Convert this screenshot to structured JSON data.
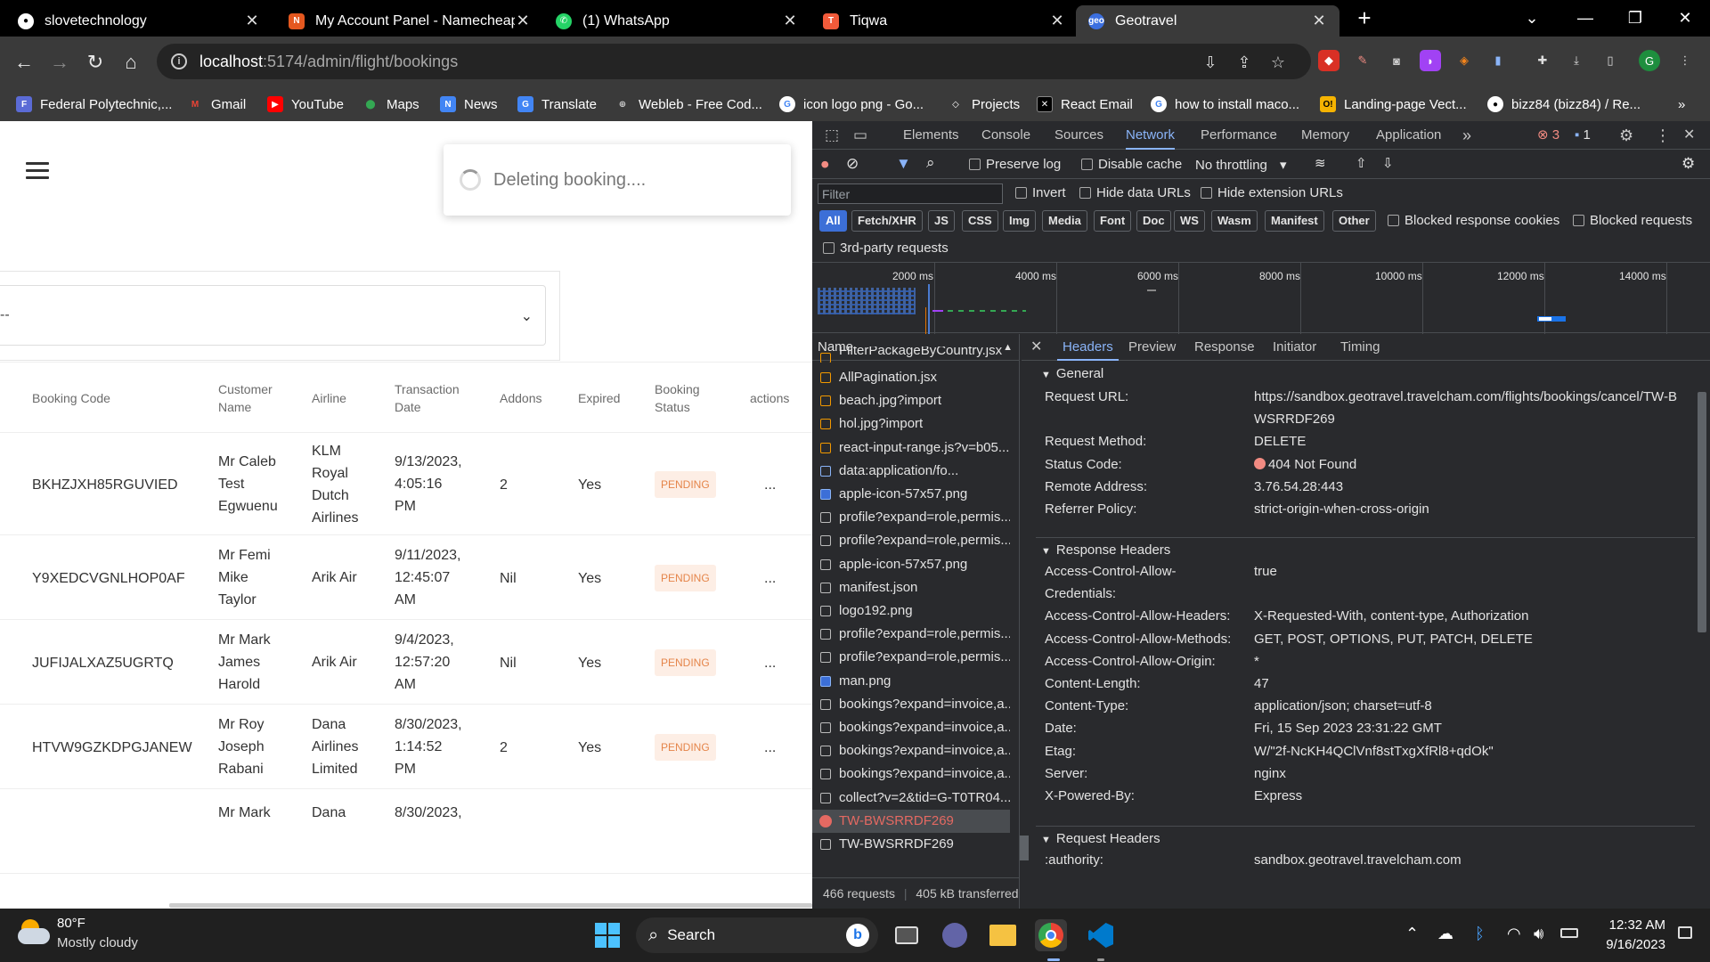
{
  "tabs": [
    {
      "title": "slovetechnology",
      "icon": "github-icon"
    },
    {
      "title": "My Account Panel - Namecheap",
      "icon": "namecheap-icon"
    },
    {
      "title": "(1) WhatsApp",
      "icon": "whatsapp-icon"
    },
    {
      "title": "Tiqwa",
      "icon": "tiqwa-icon"
    },
    {
      "title": "Geotravel",
      "icon": "geotravel-icon"
    }
  ],
  "omnibox": {
    "host": "localhost",
    "path": ":5174/admin/flight/bookings"
  },
  "bookmarks": [
    "Federal Polytechnic,...",
    "Gmail",
    "YouTube",
    "Maps",
    "News",
    "Translate",
    "Webleb - Free Cod...",
    "icon logo png - Go...",
    "Projects",
    "React Email",
    "how to install maco...",
    "Landing-page Vect...",
    "bizz84 (bizz84) / Re..."
  ],
  "page": {
    "toast": "Deleting booking....",
    "select_value": "--",
    "headers": [
      "Booking Code",
      "Customer Name",
      "Airline",
      "Transaction Date",
      "Addons",
      "Expired",
      "Booking Status",
      "actions"
    ],
    "rows": [
      {
        "code": "BKHZJXH85RGUVIED",
        "customer": [
          "Mr Caleb",
          "Test",
          "Egwuenu"
        ],
        "airline": [
          "KLM",
          "Royal",
          "Dutch",
          "Airlines"
        ],
        "date": [
          "9/13/2023,",
          "4:05:16",
          "PM"
        ],
        "addons": "2",
        "expired": "Yes",
        "status": "PENDING",
        "actions": "..."
      },
      {
        "code": "Y9XEDCVGNLHOP0AF",
        "customer": [
          "Mr Femi",
          "Mike",
          "Taylor"
        ],
        "airline": [
          "Arik Air"
        ],
        "date": [
          "9/11/2023,",
          "12:45:07",
          "AM"
        ],
        "addons": "Nil",
        "expired": "Yes",
        "status": "PENDING",
        "actions": "..."
      },
      {
        "code": "JUFIJALXAZ5UGRTQ",
        "customer": [
          "Mr Mark",
          "James",
          "Harold"
        ],
        "airline": [
          "Arik Air"
        ],
        "date": [
          "9/4/2023,",
          "12:57:20",
          "AM"
        ],
        "addons": "Nil",
        "expired": "Yes",
        "status": "PENDING",
        "actions": "..."
      },
      {
        "code": "HTVW9GZKDPGJANEW",
        "customer": [
          "Mr Roy",
          "Joseph",
          "Rabani"
        ],
        "airline": [
          "Dana",
          "Airlines",
          "Limited"
        ],
        "date": [
          "8/30/2023,",
          "1:14:52",
          "PM"
        ],
        "addons": "2",
        "expired": "Yes",
        "status": "PENDING",
        "actions": "..."
      },
      {
        "code": "",
        "customer": [
          "Mr Mark"
        ],
        "airline": [
          "Dana"
        ],
        "date": [
          "8/30/2023,"
        ],
        "addons": "",
        "expired": "",
        "status": "",
        "actions": ""
      }
    ]
  },
  "devtools": {
    "tabs": [
      "Elements",
      "Console",
      "Sources",
      "Network",
      "Performance",
      "Memory",
      "Application"
    ],
    "errors": "3",
    "messages": "1",
    "toolbar": {
      "preserve": "Preserve log",
      "disable_cache": "Disable cache",
      "throttle": "No throttling"
    },
    "filter_placeholder": "Filter",
    "filter_opts": [
      "Invert",
      "Hide data URLs",
      "Hide extension URLs"
    ],
    "types": [
      "All",
      "Fetch/XHR",
      "JS",
      "CSS",
      "Img",
      "Media",
      "Font",
      "Doc",
      "WS",
      "Wasm",
      "Manifest",
      "Other"
    ],
    "blocked": [
      "Blocked response cookies",
      "Blocked requests"
    ],
    "third_party": "3rd-party requests",
    "ticks": [
      "2000 ms",
      "4000 ms",
      "6000 ms",
      "8000 ms",
      "10000 ms",
      "12000 ms",
      "14000 ms"
    ],
    "name_header": "Name",
    "requests": [
      {
        "name": "FilterPackageByCountry.jsx",
        "type": "js"
      },
      {
        "name": "AllPagination.jsx",
        "type": "js"
      },
      {
        "name": "beach.jpg?import",
        "type": "js"
      },
      {
        "name": "hol.jpg?import",
        "type": "js"
      },
      {
        "name": "react-input-range.js?v=b05...",
        "type": "js"
      },
      {
        "name": "data:application/fo...",
        "type": "font"
      },
      {
        "name": "apple-icon-57x57.png",
        "type": "img"
      },
      {
        "name": "profile?expand=role,permis...",
        "type": "doc"
      },
      {
        "name": "profile?expand=role,permis...",
        "type": "doc"
      },
      {
        "name": "apple-icon-57x57.png",
        "type": "doc"
      },
      {
        "name": "manifest.json",
        "type": "doc"
      },
      {
        "name": "logo192.png",
        "type": "doc"
      },
      {
        "name": "profile?expand=role,permis...",
        "type": "doc"
      },
      {
        "name": "profile?expand=role,permis...",
        "type": "doc"
      },
      {
        "name": "man.png",
        "type": "img"
      },
      {
        "name": "bookings?expand=invoice,a...",
        "type": "doc"
      },
      {
        "name": "bookings?expand=invoice,a...",
        "type": "doc"
      },
      {
        "name": "bookings?expand=invoice,a...",
        "type": "doc"
      },
      {
        "name": "bookings?expand=invoice,a...",
        "type": "doc"
      },
      {
        "name": "collect?v=2&tid=G-T0TR04...",
        "type": "doc"
      },
      {
        "name": "TW-BWSRRDF269",
        "type": "err"
      },
      {
        "name": "TW-BWSRRDF269",
        "type": "doc"
      }
    ],
    "summary": {
      "requests": "466 requests",
      "transferred": "405 kB transferred"
    },
    "detail_tabs": [
      "Headers",
      "Preview",
      "Response",
      "Initiator",
      "Timing"
    ],
    "general_title": "General",
    "general": [
      {
        "k": "Request URL:",
        "v": "https://sandbox.geotravel.travelcham.com/flights/bookings/cancel/TW-B"
      },
      {
        "k": "",
        "v": "WSRRDF269"
      },
      {
        "k": "Request Method:",
        "v": "DELETE"
      },
      {
        "k": "Status Code:",
        "v": "404 Not Found"
      },
      {
        "k": "Remote Address:",
        "v": "3.76.54.28:443"
      },
      {
        "k": "Referrer Policy:",
        "v": "strict-origin-when-cross-origin"
      }
    ],
    "response_title": "Response Headers",
    "response": [
      {
        "k": "Access-Control-Allow-",
        "v": "true"
      },
      {
        "k": "Credentials:",
        "v": ""
      },
      {
        "k": "Access-Control-Allow-Headers:",
        "v": "X-Requested-With, content-type, Authorization"
      },
      {
        "k": "Access-Control-Allow-Methods:",
        "v": "GET, POST, OPTIONS, PUT, PATCH, DELETE"
      },
      {
        "k": "Access-Control-Allow-Origin:",
        "v": "*"
      },
      {
        "k": "Content-Length:",
        "v": "47"
      },
      {
        "k": "Content-Type:",
        "v": "application/json; charset=utf-8"
      },
      {
        "k": "Date:",
        "v": "Fri, 15 Sep 2023 23:31:22 GMT"
      },
      {
        "k": "Etag:",
        "v": "W/\"2f-NcKH4QClVnf8stTxgXfRl8+qdOk\""
      },
      {
        "k": "Server:",
        "v": "nginx"
      },
      {
        "k": "X-Powered-By:",
        "v": "Express"
      }
    ],
    "request_title": "Request Headers",
    "request": [
      {
        "k": ":authority:",
        "v": "sandbox.geotravel.travelcham.com"
      }
    ]
  },
  "taskbar": {
    "weather_temp": "80°F",
    "weather_desc": "Mostly cloudy",
    "search": "Search",
    "time": "12:32 AM",
    "date": "9/16/2023"
  }
}
